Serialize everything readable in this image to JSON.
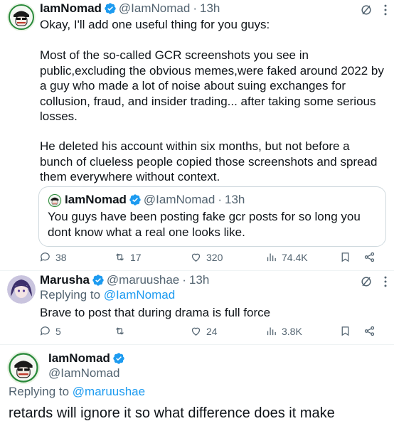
{
  "tweet1": {
    "name": "IamNomad",
    "handle": "@IamNomad",
    "dot": "·",
    "time": "13h",
    "line1": "Okay, I'll add one useful thing for you guys:",
    "para1": "Most of the so-called GCR screenshots you see in\npublic,excluding the obvious memes,were faked around 2022 by\na guy who made a lot of noise about suing exchanges for\ncollusion, fraud, and insider trading... after taking some serious\nlosses.",
    "para2": "He deleted his account within six months, but not before a\nbunch of clueless people copied those screenshots and spread\nthem everywhere without context.",
    "quote": {
      "name": "IamNomad",
      "handle": "@IamNomad",
      "dot": "·",
      "time": "13h",
      "text": "You guys have been posting fake gcr posts for so long you\ndont know what a real one looks like."
    },
    "stats": {
      "replies": "38",
      "retweets": "17",
      "likes": "320",
      "views": "74.4K"
    }
  },
  "tweet2": {
    "name": "Marusha",
    "handle": "@maruushae",
    "dot": "·",
    "time": "13h",
    "replying_prefix": "Replying to ",
    "replying_to": "@IamNomad",
    "text": "Brave to post that during drama is full force",
    "stats": {
      "replies": "5",
      "retweets": "",
      "likes": "24",
      "views": "3.8K"
    }
  },
  "tweet3": {
    "name": "IamNomad",
    "handle": "@IamNomad",
    "replying_prefix": "Replying to ",
    "replying_to": "@maruushae",
    "text": "retards will ignore it so what difference does it make"
  },
  "colors": {
    "verified": "#1d9bf0",
    "link": "#1d9bf0",
    "muted": "#536471"
  },
  "icons": [
    "grok-icon",
    "more-icon",
    "reply-icon",
    "retweet-icon",
    "like-icon",
    "views-icon",
    "bookmark-icon",
    "share-icon",
    "verified-icon"
  ]
}
